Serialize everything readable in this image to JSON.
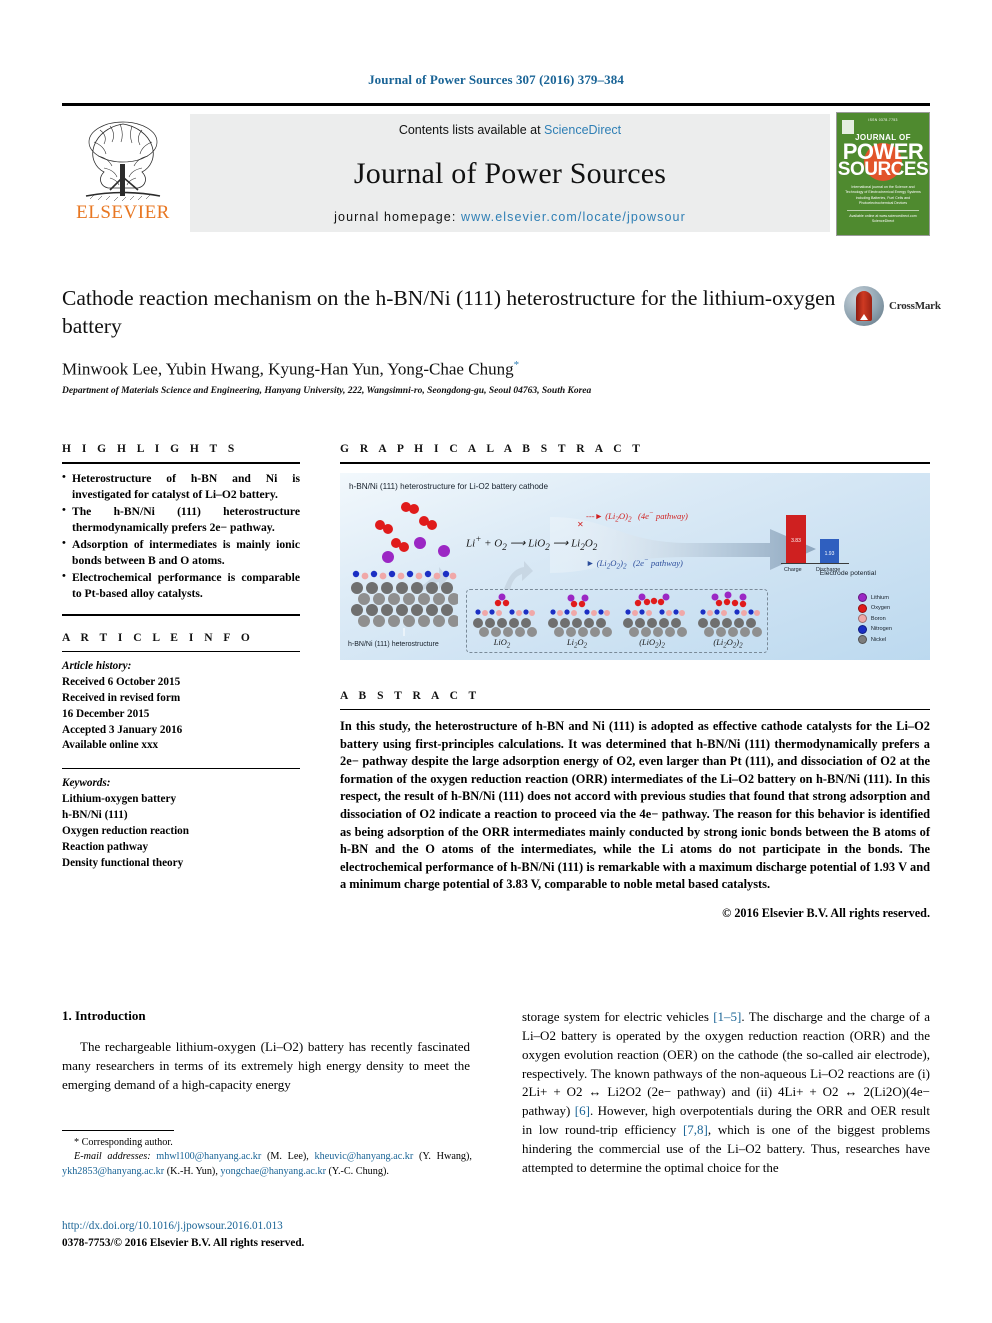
{
  "running_head": "Journal of Power Sources 307 (2016) 379–384",
  "masthead": {
    "contents_prefix": "Contents lists available at",
    "contents_link": "ScienceDirect",
    "journal_name": "Journal of Power Sources",
    "homepage_prefix": "journal homepage:",
    "homepage_url": "www.elsevier.com/locate/jpowsour",
    "publisher": "ELSEVIER",
    "cover": {
      "top_label": "ISSN 0378-7753",
      "journal_of": "JOURNAL OF",
      "power": "POWER",
      "sources": "SOURCES",
      "blurb": "International journal on the Science and Technology of Electrochemical Energy Systems including Batteries, Fuel Cells and Photoelectrochemical Devices",
      "bottom": "Available online at www.sciencedirect.com  ScienceDirect"
    }
  },
  "article": {
    "title": "Cathode reaction mechanism on the h-BN/Ni (111) heterostructure for the lithium-oxygen battery",
    "authors": "Minwook Lee, Yubin Hwang, Kyung-Han Yun, Yong-Chae Chung",
    "corresponding_marker": "*",
    "affiliation": "Department of Materials Science and Engineering, Hanyang University, 222, Wangsimni-ro, Seongdong-gu, Seoul 04763, South Korea",
    "crossmark_label": "CrossMark"
  },
  "highlights": {
    "heading": "H I G H L I G H T S",
    "items": [
      "Heterostructure of h-BN and Ni is investigated for catalyst of Li–O2 battery.",
      "The h-BN/Ni (111) heterostructure thermodynamically prefers 2e− pathway.",
      "Adsorption of intermediates is mainly ionic bonds between B and O atoms.",
      "Electrochemical performance is comparable to Pt-based alloy catalysts."
    ]
  },
  "article_info": {
    "heading": "A R T I C L E   I N F O",
    "history_label": "Article history:",
    "history": [
      "Received 6 October 2015",
      "Received in revised form",
      "16 December 2015",
      "Accepted 3 January 2016",
      "Available online xxx"
    ],
    "keywords_label": "Keywords:",
    "keywords": [
      "Lithium-oxygen battery",
      "h-BN/Ni (111)",
      "Oxygen reduction reaction",
      "Reaction pathway",
      "Density functional theory"
    ]
  },
  "graphical_abstract": {
    "heading": "G R A P H I C A L   A B S T R A C T",
    "figure_title": "h-BN/Ni (111) heterostructure for Li-O2 battery cathode",
    "equation": "Li+ + O2 ⟶ LiO2 ⟶ Li2O2",
    "pathway_4e": "(Li2O)2     (4e− pathway)",
    "pathway_2e": "(Li2O2)2     (2e− pathway)",
    "slab_label": "h-BN/Ni (111) heterostructure",
    "structures": [
      "LiO2",
      "Li2O2",
      "(LiO2)2",
      "(Li2O2)2"
    ],
    "bar_chart_caption": "Electrode potential",
    "bars": [
      {
        "name": "Charge",
        "value": "3.83",
        "color": "#cf2020"
      },
      {
        "name": "Discharge",
        "value": "1.93",
        "color": "#2f5fbf"
      }
    ],
    "legend": [
      {
        "label": "Lithium",
        "color": "#9b27c4"
      },
      {
        "label": "Oxygen",
        "color": "#e01b1b"
      },
      {
        "label": "Boron",
        "color": "#f0a8a8"
      },
      {
        "label": "Nitrogen",
        "color": "#1b2fc4"
      },
      {
        "label": "Nickel",
        "color": "#7d7d7d"
      }
    ]
  },
  "abstract": {
    "heading": "A B S T R A C T",
    "text": "In this study, the heterostructure of h-BN and Ni (111) is adopted as effective cathode catalysts for the Li–O2 battery using first-principles calculations. It was determined that h-BN/Ni (111) thermodynamically prefers a 2e− pathway despite the large adsorption energy of O2, even larger than Pt (111), and dissociation of O2 at the formation of the oxygen reduction reaction (ORR) intermediates of the Li–O2 battery on h-BN/Ni (111). In this respect, the result of h-BN/Ni (111) does not accord with previous studies that found that strong adsorption and dissociation of O2 indicate a reaction to proceed via the 4e− pathway. The reason for this behavior is identified as being adsorption of the ORR intermediates mainly conducted by strong ionic bonds between the B atoms of h-BN and the O atoms of the intermediates, while the Li atoms do not participate in the bonds. The electrochemical performance of h-BN/Ni (111) is remarkable with a maximum discharge potential of 1.93 V and a minimum charge potential of 3.83 V, comparable to noble metal based catalysts.",
    "copyright": "© 2016 Elsevier B.V. All rights reserved."
  },
  "introduction": {
    "section_number_title": "1. Introduction",
    "left_paragraph": "The rechargeable lithium-oxygen (Li–O2) battery has recently fascinated many researchers in terms of its extremely high energy density to meet the emerging demand of a high-capacity energy",
    "right_paragraph_parts": {
      "p1": "storage system for electric vehicles ",
      "ref1": "[1–5]",
      "p2": ". The discharge and the charge of a Li–O2 battery is operated by the oxygen reduction reaction (ORR) and the oxygen evolution reaction (OER) on the cathode (the so-called air electrode), respectively. The known pathways of the non-aqueous Li–O2 reactions are (i) 2Li+ + O2 ↔ Li2O2 (2e− pathway) and (ii) 4Li+ + O2 ↔ 2(Li2O)(4e− pathway) ",
      "ref2": "[6]",
      "p3": ". However, high overpotentials during the ORR and OER result in low round-trip efficiency ",
      "ref3": "[7,8]",
      "p4": ", which is one of the biggest problems hindering the commercial use of the Li–O2 battery. Thus, researches have attempted to determine the optimal choice for the"
    }
  },
  "footnote": {
    "corresponding": "* Corresponding author.",
    "email_label": "E-mail addresses:",
    "emails": [
      {
        "address": "mhwl100@hanyang.ac.kr",
        "person": "(M. Lee)"
      },
      {
        "address": "kheuvic@hanyang.ac.kr",
        "person": "(Y. Hwang)"
      },
      {
        "address": "ykh2853@hanyang.ac.kr",
        "person": "(K.-H. Yun)"
      },
      {
        "address": "yongchae@hanyang.ac.kr",
        "person": "(Y.-C. Chung)"
      }
    ]
  },
  "doi_block": {
    "doi": "http://dx.doi.org/10.1016/j.jpowsour.2016.01.013",
    "issn_line": "0378-7753/© 2016 Elsevier B.V. All rights reserved."
  }
}
